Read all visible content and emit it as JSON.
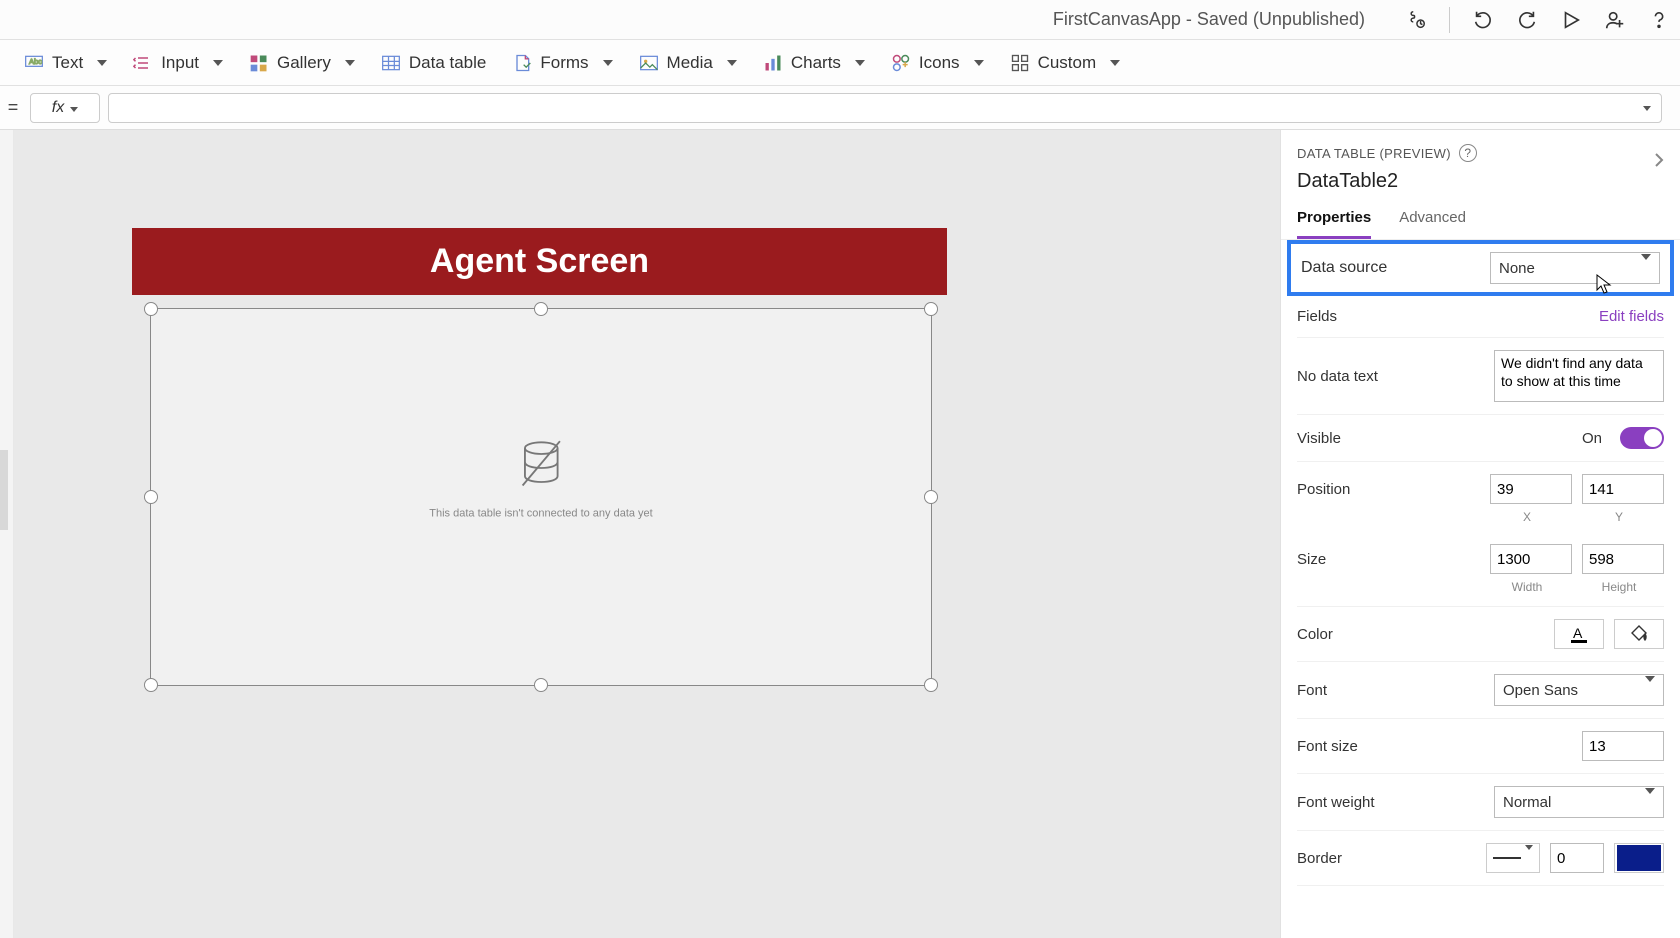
{
  "title": "FirstCanvasApp - Saved (Unpublished)",
  "ribbon": {
    "text": "Text",
    "input": "Input",
    "gallery": "Gallery",
    "datatable": "Data table",
    "forms": "Forms",
    "media": "Media",
    "charts": "Charts",
    "icons": "Icons",
    "custom": "Custom"
  },
  "formula": {
    "fx": "fx"
  },
  "canvas": {
    "screen_title": "Agent Screen",
    "empty_msg": "This data table isn't connected to any data yet"
  },
  "props": {
    "panel_label": "DATA TABLE (PREVIEW)",
    "control_name": "DataTable2",
    "tabs": {
      "properties": "Properties",
      "advanced": "Advanced"
    },
    "data_source": {
      "label": "Data source",
      "value": "None"
    },
    "fields": {
      "label": "Fields",
      "action": "Edit fields"
    },
    "no_data": {
      "label": "No data text",
      "value": "We didn't find any data to show at this time"
    },
    "visible": {
      "label": "Visible",
      "state": "On"
    },
    "position": {
      "label": "Position",
      "x": "39",
      "y": "141",
      "xlabel": "X",
      "ylabel": "Y"
    },
    "size": {
      "label": "Size",
      "w": "1300",
      "h": "598",
      "wlabel": "Width",
      "hlabel": "Height"
    },
    "color": {
      "label": "Color"
    },
    "font": {
      "label": "Font",
      "value": "Open Sans"
    },
    "font_size": {
      "label": "Font size",
      "value": "13"
    },
    "font_weight": {
      "label": "Font weight",
      "value": "Normal"
    },
    "border": {
      "label": "Border",
      "value": "0",
      "swatch": "#0a1e8a"
    }
  }
}
